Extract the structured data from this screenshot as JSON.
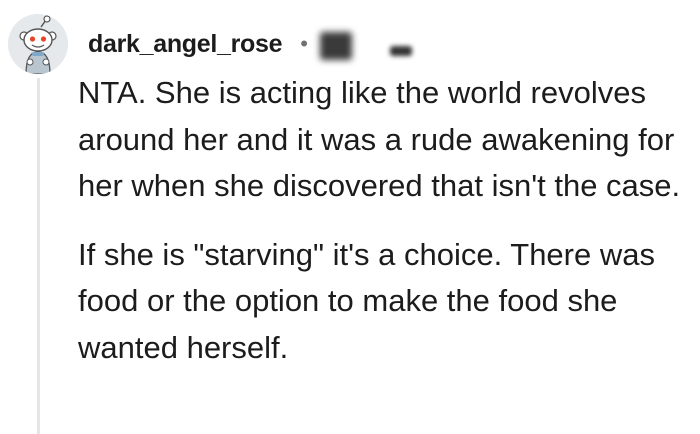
{
  "comment": {
    "username": "dark_angel_rose",
    "separator": "•",
    "paragraphs": [
      "NTA. She is acting like the world revolves around her and it was a rude awakening for her when she discovered that isn't the case.",
      "If she is \"starving\" it's a choice. There was food or the option to make the food she wanted herself."
    ]
  },
  "colors": {
    "text": "#1c1c1c",
    "meta": "#6f7275",
    "thread_line": "#e4e6e8",
    "avatar_bg": "#e6e9ec",
    "snoo_accent": "#e8452c"
  },
  "icons": {
    "avatar": "snoo-avatar-icon"
  }
}
